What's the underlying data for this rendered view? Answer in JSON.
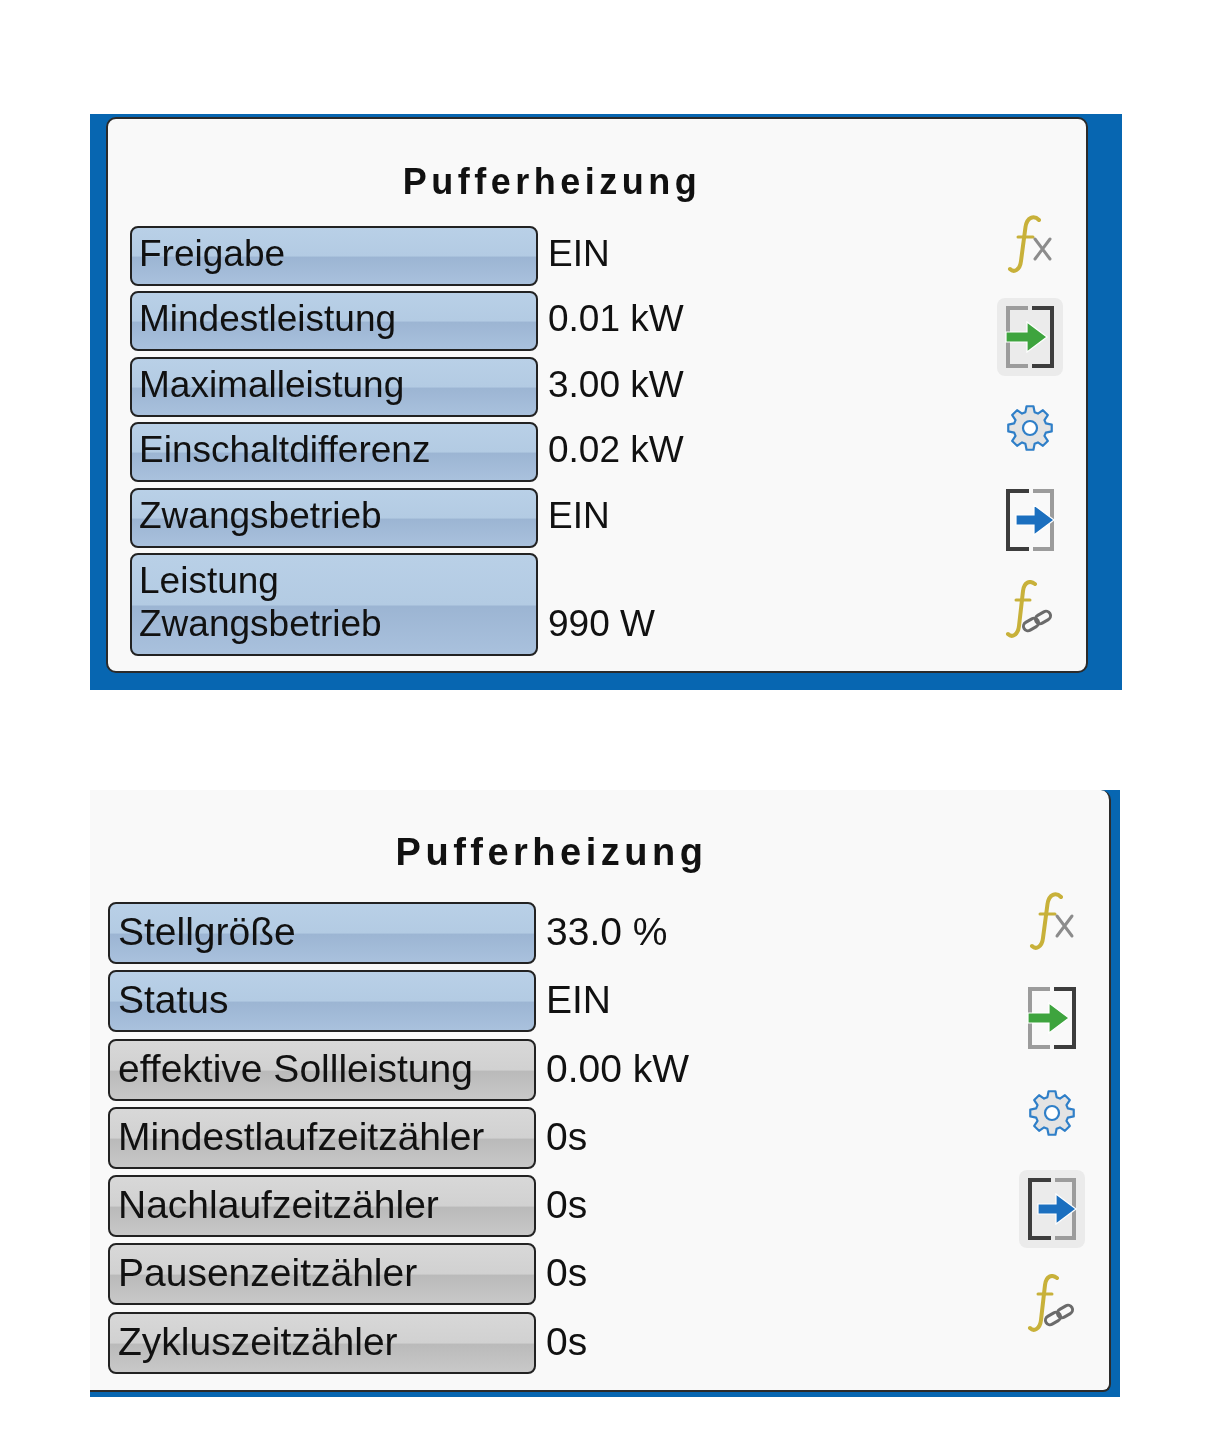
{
  "panels": [
    {
      "title": "Pufferheizung",
      "rows": [
        {
          "label": "Freigabe",
          "kind": "parameter",
          "value": "EIN"
        },
        {
          "label": "Mindestleistung",
          "kind": "parameter",
          "value": "0.01 kW"
        },
        {
          "label": "Maximalleistung",
          "kind": "parameter",
          "value": "3.00 kW"
        },
        {
          "label": "Einschaltdifferenz",
          "kind": "parameter",
          "value": "0.02 kW"
        },
        {
          "label": "Zwangsbetrieb",
          "kind": "parameter",
          "value": "EIN"
        },
        {
          "label": "Leistung\nZwangsbetrieb",
          "kind": "parameter",
          "value": "990 W"
        }
      ],
      "icons": [
        {
          "kind": "formula",
          "selected": false
        },
        {
          "kind": "input",
          "selected": true
        },
        {
          "kind": "settings",
          "selected": false
        },
        {
          "kind": "output",
          "selected": false
        },
        {
          "kind": "formula-link",
          "selected": false
        }
      ]
    },
    {
      "title": "Pufferheizung",
      "rows": [
        {
          "label": "Stellgröße",
          "kind": "parameter",
          "value": "33.0 %"
        },
        {
          "label": "Status",
          "kind": "parameter",
          "value": "EIN"
        },
        {
          "label": "effektive Sollleistung",
          "kind": "output",
          "value": "0.00 kW"
        },
        {
          "label": "Mindestlaufzeitzähler",
          "kind": "output",
          "value": "0s"
        },
        {
          "label": "Nachlaufzeitzähler",
          "kind": "output",
          "value": "0s"
        },
        {
          "label": "Pausenzeitzähler",
          "kind": "output",
          "value": "0s"
        },
        {
          "label": "Zykluszeitzähler",
          "kind": "output",
          "value": "0s"
        }
      ],
      "icons": [
        {
          "kind": "formula",
          "selected": false
        },
        {
          "kind": "input",
          "selected": false
        },
        {
          "kind": "settings",
          "selected": false
        },
        {
          "kind": "output",
          "selected": true
        },
        {
          "kind": "formula-link",
          "selected": false
        }
      ]
    }
  ]
}
